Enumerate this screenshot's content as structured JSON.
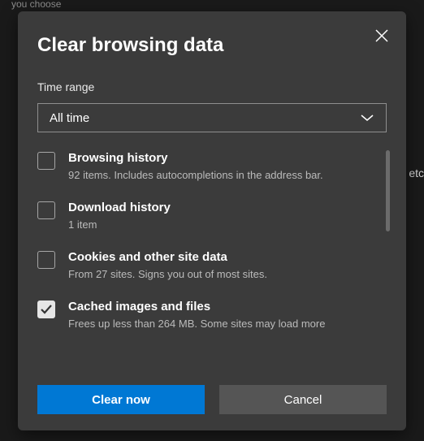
{
  "background": {
    "fragment_top": "you choose",
    "fragment_right": "etc"
  },
  "dialog": {
    "title": "Clear browsing data",
    "time_range_label": "Time range",
    "time_range_value": "All time",
    "options": [
      {
        "id": "browsing-history",
        "title": "Browsing history",
        "description": "92 items. Includes autocompletions in the address bar.",
        "checked": false
      },
      {
        "id": "download-history",
        "title": "Download history",
        "description": "1 item",
        "checked": false
      },
      {
        "id": "cookies",
        "title": "Cookies and other site data",
        "description": "From 27 sites. Signs you out of most sites.",
        "checked": false
      },
      {
        "id": "cache",
        "title": "Cached images and files",
        "description": "Frees up less than 264 MB. Some sites may load more",
        "checked": true
      }
    ],
    "buttons": {
      "primary": "Clear now",
      "secondary": "Cancel"
    }
  }
}
